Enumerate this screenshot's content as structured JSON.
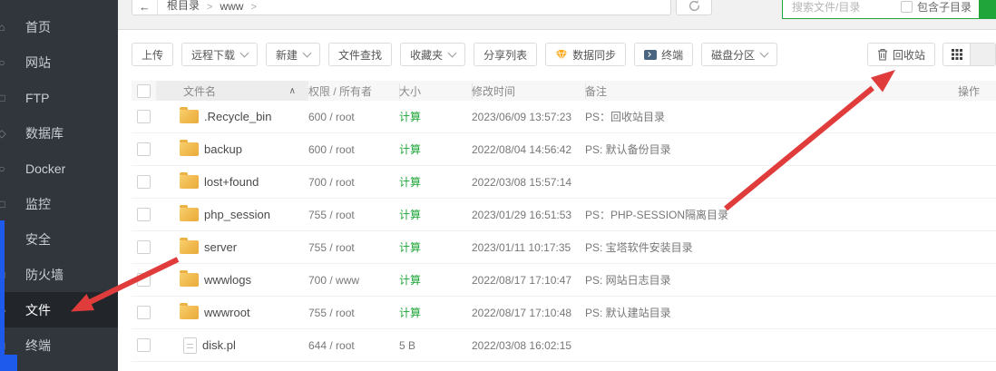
{
  "colors": {
    "accent_green": "#20a53a",
    "sidebar_bg": "#30363c",
    "arrow_red": "#e13c3c",
    "overlay_blue": "#1e5aec",
    "folder_yellow": "#f0b94e"
  },
  "sidebar": {
    "items": [
      {
        "label": "首页",
        "icon": "home-icon",
        "icon_char": "⌂",
        "active": false
      },
      {
        "label": "网站",
        "icon": "site-icon",
        "icon_char": "○",
        "active": false
      },
      {
        "label": "FTP",
        "icon": "ftp-icon",
        "icon_char": "□",
        "active": false
      },
      {
        "label": "数据库",
        "icon": "database-icon",
        "icon_char": "◇",
        "active": false
      },
      {
        "label": "Docker",
        "icon": "docker-icon",
        "icon_char": "○",
        "active": false
      },
      {
        "label": "监控",
        "icon": "monitor-icon",
        "icon_char": "□",
        "active": false
      },
      {
        "label": "安全",
        "icon": "security-icon",
        "icon_char": "○",
        "active": false
      },
      {
        "label": "防火墙",
        "icon": "firewall-icon",
        "icon_char": "□",
        "active": false
      },
      {
        "label": "文件",
        "icon": "files-icon",
        "icon_char": "◇",
        "active": true
      },
      {
        "label": "终端",
        "icon": "terminal-icon",
        "icon_char": "□",
        "active": false
      }
    ]
  },
  "topbar": {
    "back_arrow": "←",
    "breadcrumb": {
      "root": "根目录",
      "sep1": ">",
      "current": "www",
      "sep2": ">"
    }
  },
  "search": {
    "placeholder": "搜索文件/目录",
    "include_sub_label": "包含子目录"
  },
  "toolbar": {
    "buttons": [
      {
        "label": "上传",
        "caret": false
      },
      {
        "label": "远程下载",
        "caret": true
      },
      {
        "label": "新建",
        "caret": true
      },
      {
        "label": "文件查找",
        "caret": false
      },
      {
        "label": "收藏夹",
        "caret": true
      },
      {
        "label": "分享列表",
        "caret": false
      },
      {
        "label": "数据同步",
        "caret": false,
        "icon": "gem-icon"
      },
      {
        "label": "终端",
        "caret": false,
        "icon": "terminal-window-icon"
      },
      {
        "label": "磁盘分区",
        "caret": true
      }
    ],
    "recycle_label": "回收站"
  },
  "table": {
    "sort_caret": "∧",
    "columns": {
      "name": "文件名",
      "perm": "权限 / 所有者",
      "size": "大小",
      "time": "修改时间",
      "note": "备注",
      "action": "操作"
    },
    "rows": [
      {
        "type": "folder",
        "name": ".Recycle_bin",
        "perm": "600 / root",
        "size": "计算",
        "time": "2023/06/09 13:57:23",
        "note": "PS：回收站目录"
      },
      {
        "type": "folder",
        "name": "backup",
        "perm": "600 / root",
        "size": "计算",
        "time": "2022/08/04 14:56:42",
        "note": "PS: 默认备份目录"
      },
      {
        "type": "folder",
        "name": "lost+found",
        "perm": "700 / root",
        "size": "计算",
        "time": "2022/03/08 15:57:14",
        "note": ""
      },
      {
        "type": "folder",
        "name": "php_session",
        "perm": "755 / root",
        "size": "计算",
        "time": "2023/01/29 16:51:53",
        "note": "PS：PHP-SESSION隔离目录"
      },
      {
        "type": "folder",
        "name": "server",
        "perm": "755 / root",
        "size": "计算",
        "time": "2023/01/11 10:17:35",
        "note": "PS: 宝塔软件安装目录"
      },
      {
        "type": "folder",
        "name": "wwwlogs",
        "perm": "700 / www",
        "size": "计算",
        "time": "2022/08/17 17:10:47",
        "note": "PS: 网站日志目录"
      },
      {
        "type": "folder",
        "name": "wwwroot",
        "perm": "755 / root",
        "size": "计算",
        "time": "2022/08/17 17:10:48",
        "note": "PS: 默认建站目录"
      },
      {
        "type": "file",
        "name": "disk.pl",
        "perm": "644 / root",
        "size": "5 B",
        "time": "2022/03/08 16:02:15",
        "note": ""
      }
    ]
  }
}
